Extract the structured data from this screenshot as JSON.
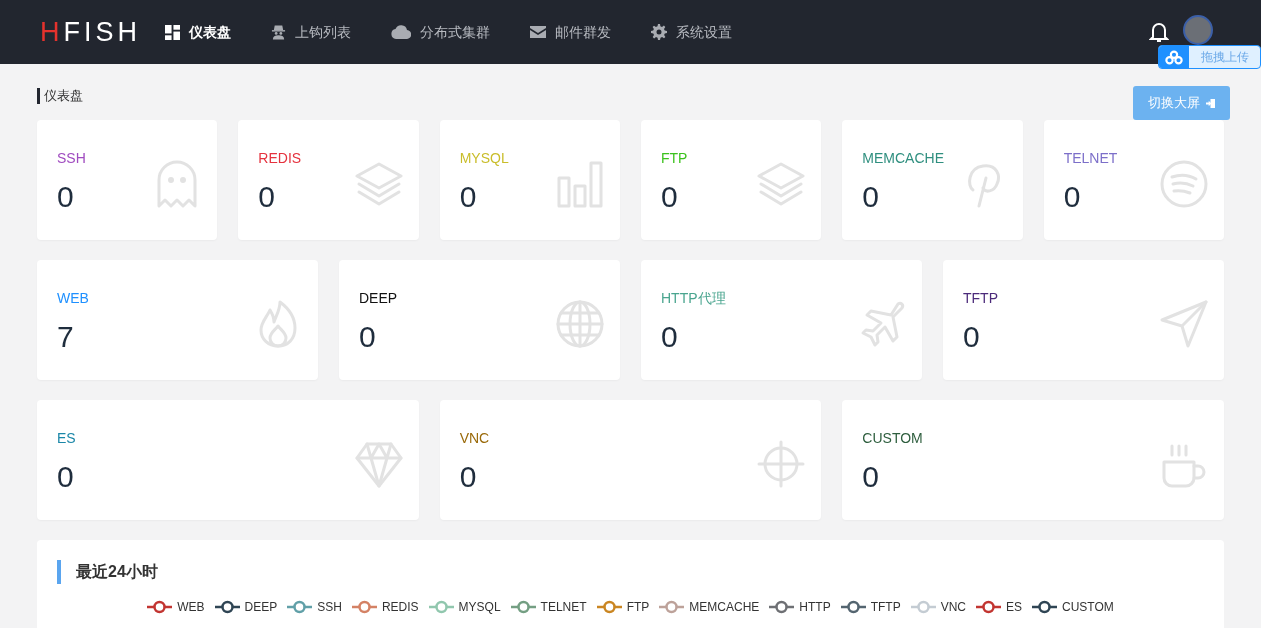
{
  "logo": {
    "text": "HFISH"
  },
  "nav": [
    {
      "label": "仪表盘",
      "selected": true
    },
    {
      "label": "上钩列表",
      "selected": false
    },
    {
      "label": "分布式集群",
      "selected": false
    },
    {
      "label": "邮件群发",
      "selected": false
    },
    {
      "label": "系统设置",
      "selected": false
    }
  ],
  "upload_widget": {
    "label": "拖拽上传"
  },
  "page_title": "仪表盘",
  "fullscreen_button": "切换大屏",
  "card_rows": [
    [
      {
        "label": "SSH",
        "value": "0",
        "color": "#a04cc0",
        "kind": "ghost"
      },
      {
        "label": "REDIS",
        "value": "0",
        "color": "#e5323e",
        "kind": "layers"
      },
      {
        "label": "MYSQL",
        "value": "0",
        "color": "#c9bd2a",
        "kind": "bars"
      },
      {
        "label": "FTP",
        "value": "0",
        "color": "#3cc21e",
        "kind": "layers"
      },
      {
        "label": "MEMCACHE",
        "value": "0",
        "color": "#2f8f7f",
        "kind": "pin"
      },
      {
        "label": "TELNET",
        "value": "0",
        "color": "#7c6fc9",
        "kind": "waves"
      }
    ],
    [
      {
        "label": "WEB",
        "value": "7",
        "color": "#1e90ff",
        "kind": "flame"
      },
      {
        "label": "DEEP",
        "value": "0",
        "color": "#111111",
        "kind": "globe"
      },
      {
        "label": "HTTP代理",
        "value": "0",
        "color": "#4aa58f",
        "kind": "plane"
      },
      {
        "label": "TFTP",
        "value": "0",
        "color": "#4b2a7a",
        "kind": "send"
      }
    ],
    [
      {
        "label": "ES",
        "value": "0",
        "color": "#1b87a8",
        "kind": "diamond"
      },
      {
        "label": "VNC",
        "value": "0",
        "color": "#9a6a0a",
        "kind": "crosshair"
      },
      {
        "label": "CUSTOM",
        "value": "0",
        "color": "#2e5e3e",
        "kind": "mug"
      }
    ]
  ],
  "chart_panel": {
    "title": "最近24小时",
    "legend": [
      {
        "name": "WEB",
        "color": "#c23531"
      },
      {
        "name": "DEEP",
        "color": "#2f4554"
      },
      {
        "name": "SSH",
        "color": "#61a0a8"
      },
      {
        "name": "REDIS",
        "color": "#d48265"
      },
      {
        "name": "MYSQL",
        "color": "#91c7ae"
      },
      {
        "name": "TELNET",
        "color": "#749f83"
      },
      {
        "name": "FTP",
        "color": "#ca8622"
      },
      {
        "name": "MEMCACHE",
        "color": "#bda29a"
      },
      {
        "name": "HTTP",
        "color": "#6e7074"
      },
      {
        "name": "TFTP",
        "color": "#546570"
      },
      {
        "name": "VNC",
        "color": "#c4ccd3"
      },
      {
        "name": "ES",
        "color": "#c23531"
      },
      {
        "name": "CUSTOM",
        "color": "#2f4554"
      }
    ]
  }
}
